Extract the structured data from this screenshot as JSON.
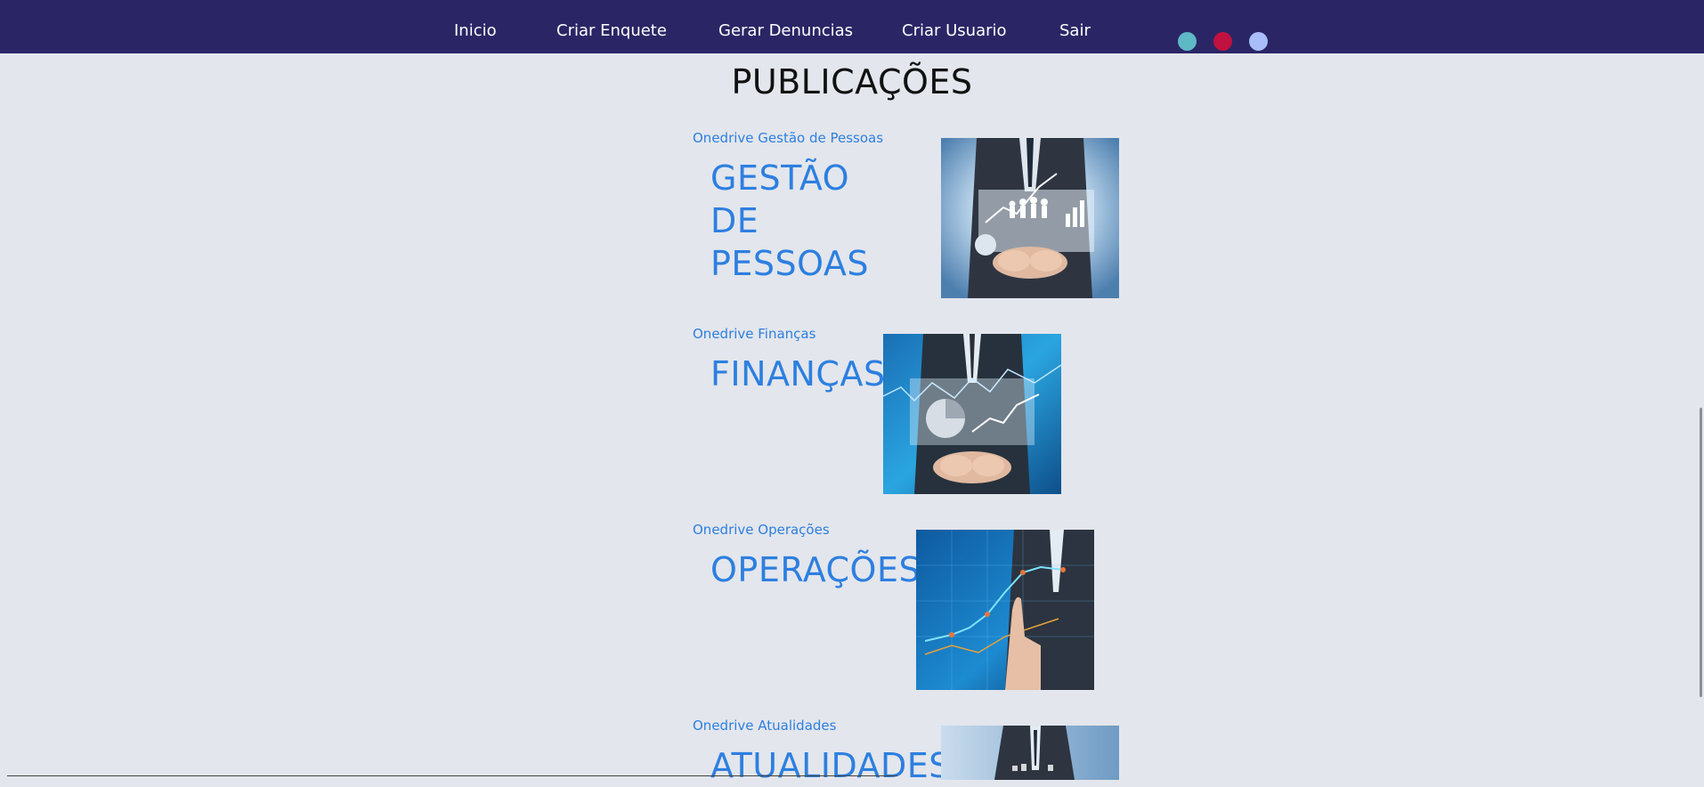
{
  "nav": {
    "items": [
      "Inicio",
      "Criar Enquete",
      "Gerar Denuncias",
      "Criar Usuario",
      "Sair"
    ],
    "dots": [
      {
        "color": "#5fb8c6",
        "name": "theme-dot-teal"
      },
      {
        "color": "#c0113f",
        "name": "theme-dot-crimson"
      },
      {
        "color": "#a9bdfa",
        "name": "theme-dot-lavender"
      }
    ],
    "background": "#2a2666"
  },
  "page": {
    "title": "PUBLICAÇÕES"
  },
  "publications": [
    {
      "link": "Onedrive Gestão de Pessoas",
      "heading": "GESTÃO DE PESSOAS",
      "image": "businessman-holding-people-analytics-image"
    },
    {
      "link": "Onedrive Finanças",
      "heading": "FINANÇAS",
      "image": "businessman-holding-finance-charts-image"
    },
    {
      "link": "Onedrive Operações",
      "heading": "OPERAÇÕES",
      "image": "businessman-touching-growth-chart-image"
    },
    {
      "link": "Onedrive Atualidades",
      "heading": "ATUALIDADES",
      "image": "businessman-news-image"
    }
  ],
  "colors": {
    "accent": "#2d7fe0",
    "background": "#e3e6ec"
  }
}
